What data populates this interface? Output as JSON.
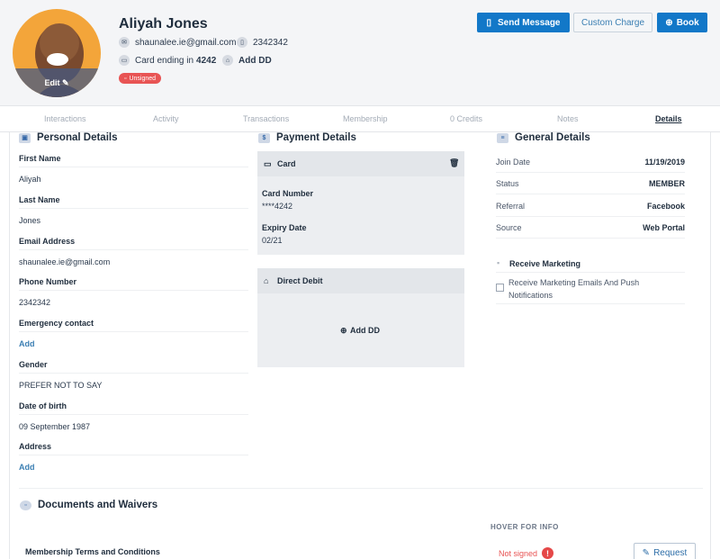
{
  "profile": {
    "name": "Aliyah Jones",
    "email": "shaunalee.ie@gmail.com",
    "phone": "2342342",
    "card_prefix": "Card ending in",
    "card_last4": "4242",
    "add_dd": "Add DD",
    "badge": "Unsigned",
    "avatar_edit": "Edit"
  },
  "actions": {
    "send_message": "Send Message",
    "custom_charge": "Custom Charge",
    "book": "Book"
  },
  "tabs": [
    "Interactions",
    "Activity",
    "Transactions",
    "Membership",
    "0 Credits",
    "Notes",
    "Details"
  ],
  "personal": {
    "title": "Personal Details",
    "fields": [
      {
        "label": "First Name",
        "value": "Aliyah"
      },
      {
        "label": "Last Name",
        "value": "Jones"
      },
      {
        "label": "Email Address",
        "value": "shaunalee.ie@gmail.com"
      },
      {
        "label": "Phone Number",
        "value": "2342342"
      },
      {
        "label": "Emergency contact",
        "value": "Add"
      },
      {
        "label": "Gender",
        "value": "PREFER NOT TO SAY"
      },
      {
        "label": "Date of birth",
        "value": "09 September 1987"
      },
      {
        "label": "Address",
        "value": "Add"
      }
    ]
  },
  "payment": {
    "title": "Payment Details",
    "card_title": "Card",
    "card_number_label": "Card Number",
    "card_number": "****4242",
    "expiry_label": "Expiry Date",
    "expiry": "02/21",
    "dd_title": "Direct Debit",
    "add_dd": "Add DD"
  },
  "general": {
    "title": "General Details",
    "rows": [
      {
        "label": "Join Date",
        "value": "11/19/2019"
      },
      {
        "label": "Status",
        "value": "MEMBER"
      },
      {
        "label": "Referral",
        "value": "Facebook"
      },
      {
        "label": "Source",
        "value": "Web Portal"
      }
    ],
    "marketing_title": "Receive Marketing",
    "marketing_option": "Receive Marketing Emails And Push Notifications"
  },
  "docs": {
    "title": "Documents and Waivers",
    "hover_info": "HOVER FOR INFO",
    "item": "Membership Terms and Conditions",
    "status": "Not signed",
    "request": "Request"
  },
  "colors": {
    "primary": "#1278c8",
    "danger": "#e85454",
    "link": "#3b7fb3"
  }
}
